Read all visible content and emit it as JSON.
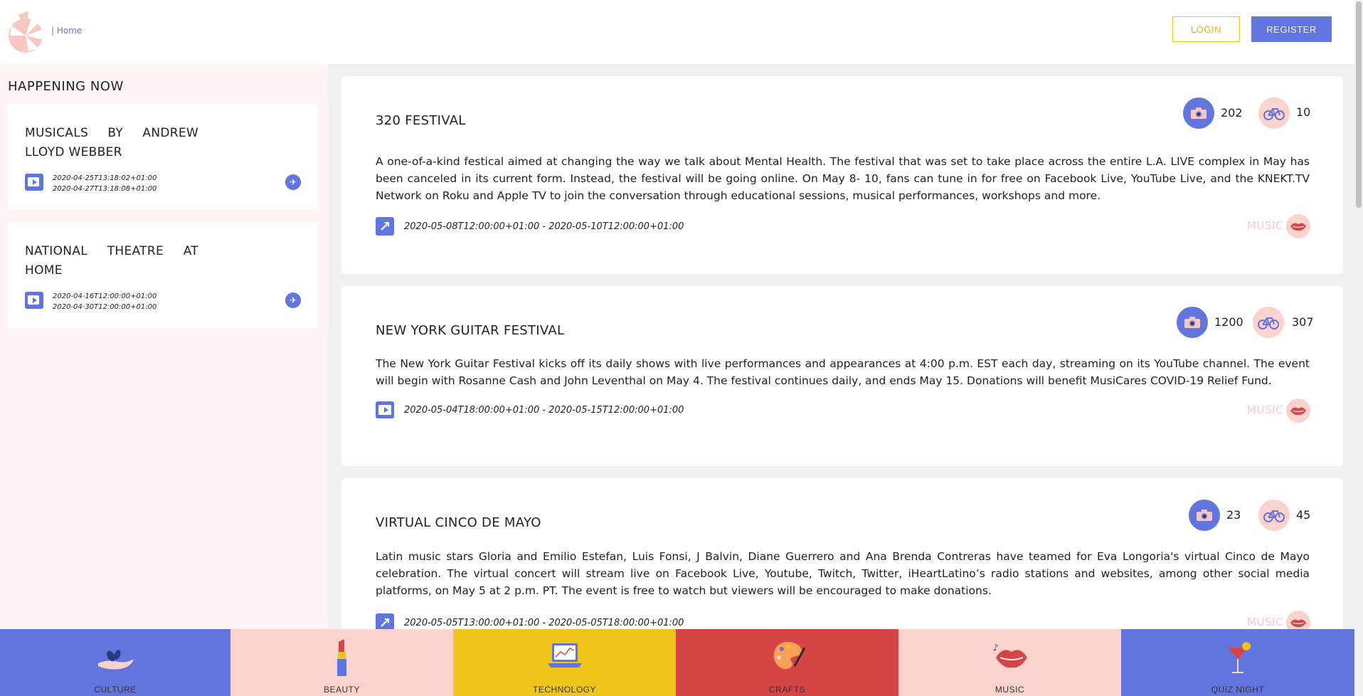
{
  "header": {
    "home_link": "| Home",
    "login_label": "LOGIN",
    "register_label": "REGISTER"
  },
  "sidebar": {
    "title": "HAPPENING NOW",
    "items": [
      {
        "title": "MUSICALS BY ANDREW LLOYD WEBBER",
        "start": "2020-04-25T13:18:02+01:00",
        "end": "2020-04-27T13:18:08+01:00"
      },
      {
        "title": "NATIONAL THEATRE AT HOME",
        "start": "2020-04-16T12:00:00+01:00",
        "end": "2020-04-30T12:00:00+01:00"
      }
    ]
  },
  "events": [
    {
      "title": "320 FESTIVAL",
      "description": "A one-of-a-kind festical aimed at changing the way we talk about Mental Health. The festival that was set to take place across the entire L.A. LIVE complex in May has been canceled in its current form. Instead, the festival will be going online. On May 8- 10, fans can tune in for free on Facebook Live, YouTube Live, and the KNEKT.TV Network on Roku and Apple TV to join the conversation through educational sessions, musical performances, workshops and more.",
      "dates": "2020-05-08T12:00:00+01:00 - 2020-05-10T12:00:00+01:00",
      "category": "MUSIC",
      "camera_count": "202",
      "bike_count": "10",
      "link_type": "link"
    },
    {
      "title": "NEW YORK GUITAR FESTIVAL",
      "description": "The New York Guitar Festival kicks off its daily shows with live performances and appearances at 4:00 p.m. EST each day, streaming on its YouTube channel. The event will begin with Rosanne Cash and John Leventhal on May 4. The festival continues daily, and ends May 15. Donations will benefit MusiCares COVID-19 Relief Fund.",
      "dates": "2020-05-04T18:00:00+01:00 - 2020-05-15T12:00:00+01:00",
      "category": "MUSIC",
      "camera_count": "1200",
      "bike_count": "307",
      "link_type": "video"
    },
    {
      "title": "VIRTUAL CINCO DE MAYO",
      "description": "Latin music stars Gloria and Emilio Estefan, Luis Fonsi, J Balvin, Diane Guerrero and Ana Brenda Contreras have teamed for Eva Longoria's virtual Cinco de Mayo celebration. The virtual concert will stream live on Facebook Live, Youtube, Twitch, Twitter, iHeartLatino’s radio stations and websites, among other social media platforms, on May 5 at 2 p.m. PT. The event is free to watch but viewers will be encouraged to make donations.",
      "dates": "2020-05-05T13:00:00+01:00 - 2020-05-05T18:00:00+01:00",
      "category": "MUSIC",
      "camera_count": "23",
      "bike_count": "45",
      "link_type": "link"
    }
  ],
  "bottom_nav": [
    {
      "label": "CULTURE",
      "color": "#6275de",
      "icon": "hand-icon"
    },
    {
      "label": "BEAUTY",
      "color": "#fcd2cc",
      "icon": "lipstick-icon"
    },
    {
      "label": "TECHNOLOGY",
      "color": "#f0c419",
      "icon": "laptop-icon"
    },
    {
      "label": "CRAFTS",
      "color": "#d54545",
      "icon": "palette-icon"
    },
    {
      "label": "MUSIC",
      "color": "#fcd2cc",
      "icon": "lips-icon"
    },
    {
      "label": "QUIZ NIGHT",
      "color": "#6275de",
      "icon": "cocktail-icon"
    }
  ],
  "colors": {
    "accent_blue": "#6275de",
    "accent_pink": "#fcd2cc",
    "accent_yellow": "#f0c419",
    "accent_red": "#d54545"
  }
}
